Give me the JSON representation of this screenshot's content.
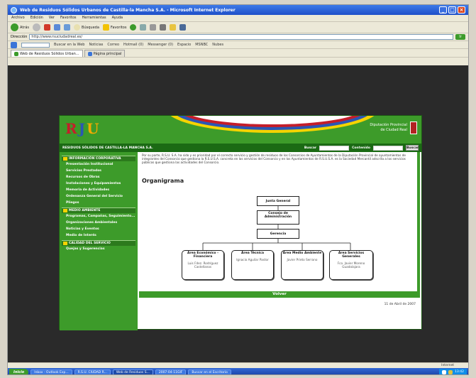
{
  "window": {
    "title": "Web de Residuos Sólidos Urbanos de Castilla-la Mancha S.A. - Microsoft Internet Explorer",
    "minimize": "_",
    "maximize": "□",
    "close": "×"
  },
  "menu": [
    "Archivo",
    "Edición",
    "Ver",
    "Favoritos",
    "Herramientas",
    "Ayuda"
  ],
  "toolbar": {
    "back": "Atrás",
    "search": "Búsqueda",
    "favorites": "Favoritos"
  },
  "address": {
    "label": "Dirección",
    "url": "http://www.rsuciudadreal.es/",
    "go": "Ir"
  },
  "links": {
    "items": [
      "Buscar en la Web",
      "Noticias",
      "Correo",
      "Hotmail (0)",
      "Messenger (0)",
      "Espacio",
      "MSNBC",
      "Nubes"
    ]
  },
  "tabs": [
    {
      "label": "Web de Residuos Sólidos Urban..."
    },
    {
      "label": "Página principal"
    }
  ],
  "site": {
    "logo": {
      "a": "",
      "r": "R",
      "j": "J",
      "v": "U"
    },
    "institution_line1": "Diputación Provincial",
    "institution_line2": "de Ciudad Real",
    "company": "RESIDUOS SÓLIDOS DE CASTILLA-LA MANCHA S.A.",
    "search_label1": "Buscar",
    "search_label2": "Contenido",
    "search_button": "Buscar",
    "sidebar": [
      {
        "heading": "INFORMACIÓN CORPORATIVA",
        "items": [
          "Presentación Institucional",
          "Servicios Prestados",
          "Recursos de Obras",
          "Instalaciones y Equipamientos",
          "Memoria de Actividades",
          "Ordenanza General del Servicio",
          "Pliegos"
        ]
      },
      {
        "heading": "MEDIO AMBIENTE",
        "items": [
          "Programas, Campañas, Seguimiento...",
          "Organizaciones Ambientales",
          "Noticias y Eventos",
          "Medio de Interés"
        ]
      },
      {
        "heading": "CALIDAD DEL SERVICIO",
        "items": [
          "Quejas y Sugerencias"
        ]
      }
    ],
    "intro_text": "Por su parte, R.S.U. S.A. ha sido y es prioridad por el correcto servicio y gestión de residuos de los Consorcios de Ayuntamientos de la Diputación Provincial de ayuntamientos de integrantes del Consorcio que gestiona la R.S.U.S.A. concreta en los servicios del Consorcio y en los Ayuntamientos de R.S.U.S.A. es la Sociedad Mercantil adscrita a los servicios públicos que gestiona las actividades del Consorcio.",
    "org_title": "Organigrama",
    "org": {
      "junta": "Junta General",
      "consejo": "Consejo de Administración",
      "gerencia": "Gerencia",
      "areas": [
        {
          "title": "Área Económico - Financiera",
          "person": "Luis Fdez. Rodríguez Castellanos"
        },
        {
          "title": "Área Técnica",
          "person": "Ignacio Aguilar Pastor"
        },
        {
          "title": "Área Medio Ambiente",
          "person": "Javier Prieto Serrano"
        },
        {
          "title": "Área Servicios Generales",
          "person": "Fco. Javier Moreno Guadalajara"
        }
      ]
    },
    "back_link": "Volver",
    "date": "11 de Abril de 2007"
  },
  "status": {
    "zone": "Internet"
  },
  "taskbar": {
    "start": "Inicio",
    "tasks": [
      "Inbox - Outlook Exp...",
      "R.S.U. CIUDAD R...",
      "Web de Residuos S...",
      "2007-04-11GIF",
      "Buscar en el Escritorio"
    ],
    "clock": "13:42"
  },
  "colors": {
    "site_green": "#3d9b2a",
    "dark_green": "#1b6a14",
    "ie_blue": "#1f4fc8"
  }
}
